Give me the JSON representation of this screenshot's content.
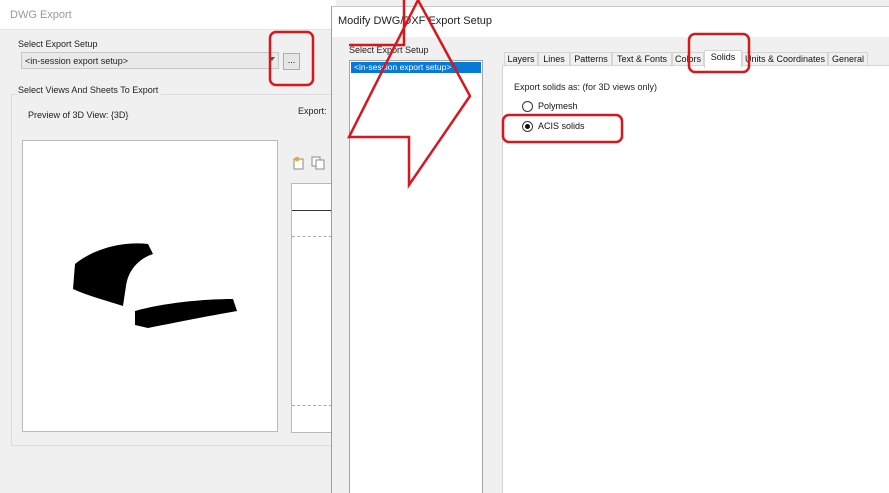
{
  "background_dialog": {
    "title": "DWG Export",
    "select_setup_label": "Select Export Setup",
    "setup_value": "<in-session export setup>",
    "ellipsis_label": "...",
    "views_group_label": "Select Views And Sheets To Export",
    "preview_label": "Preview of 3D View: {3D}",
    "export_label": "Export:"
  },
  "front_dialog": {
    "title": "Modify DWG/DXF Export Setup",
    "setup_list_label": "Select Export Setup",
    "setup_list_items": [
      "<in-session export setup>"
    ],
    "tabs": [
      {
        "label": "Layers",
        "active": false
      },
      {
        "label": "Lines",
        "active": false
      },
      {
        "label": "Patterns",
        "active": false
      },
      {
        "label": "Text & Fonts",
        "active": false
      },
      {
        "label": "Colors",
        "active": false
      },
      {
        "label": "Solids",
        "active": true
      },
      {
        "label": "Units & Coordinates",
        "active": false
      },
      {
        "label": "General",
        "active": false
      }
    ],
    "solids": {
      "export_label": "Export solids as: (for 3D views only)",
      "options": [
        {
          "label": "Polymesh",
          "selected": false
        },
        {
          "label": "ACIS solids",
          "selected": true
        }
      ]
    }
  },
  "annotation_color": "#d8161d"
}
